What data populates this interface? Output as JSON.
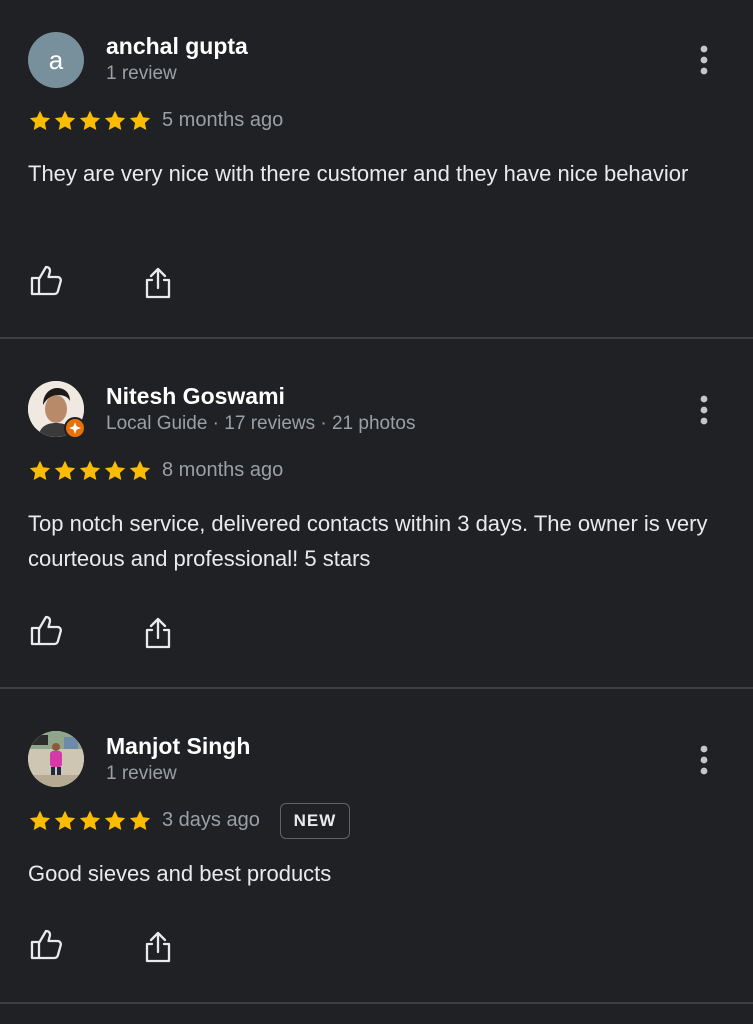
{
  "colors": {
    "background": "#202124",
    "star": "#fbbc04",
    "divider": "#3c4043",
    "secondary_text": "#9aa0a6",
    "local_guide_badge": "#e8710a"
  },
  "reviews": [
    {
      "name": "anchal gupta",
      "meta": "1 review",
      "avatar_letter": "a",
      "rating": 5,
      "time": "5 months ago",
      "text": "They are very nice with there customer and they have nice behavior",
      "icons": [
        "thumbs-up-icon",
        "share-icon",
        "more-vert-icon"
      ]
    },
    {
      "name": "Nitesh Goswami",
      "meta": "Local Guide · 17 reviews · 21 photos",
      "rating": 5,
      "time": "8 months ago",
      "text": "Top notch service, delivered contacts within 3 days. The owner is very courteous and professional! 5 stars",
      "icons": [
        "thumbs-up-icon",
        "share-icon",
        "more-vert-icon",
        "local-guide-badge-icon"
      ]
    },
    {
      "name": "Manjot Singh",
      "meta": "1 review",
      "rating": 5,
      "time": "3 days ago",
      "badge": "NEW",
      "text": "Good sieves and best products",
      "icons": [
        "thumbs-up-icon",
        "share-icon",
        "more-vert-icon"
      ]
    }
  ]
}
